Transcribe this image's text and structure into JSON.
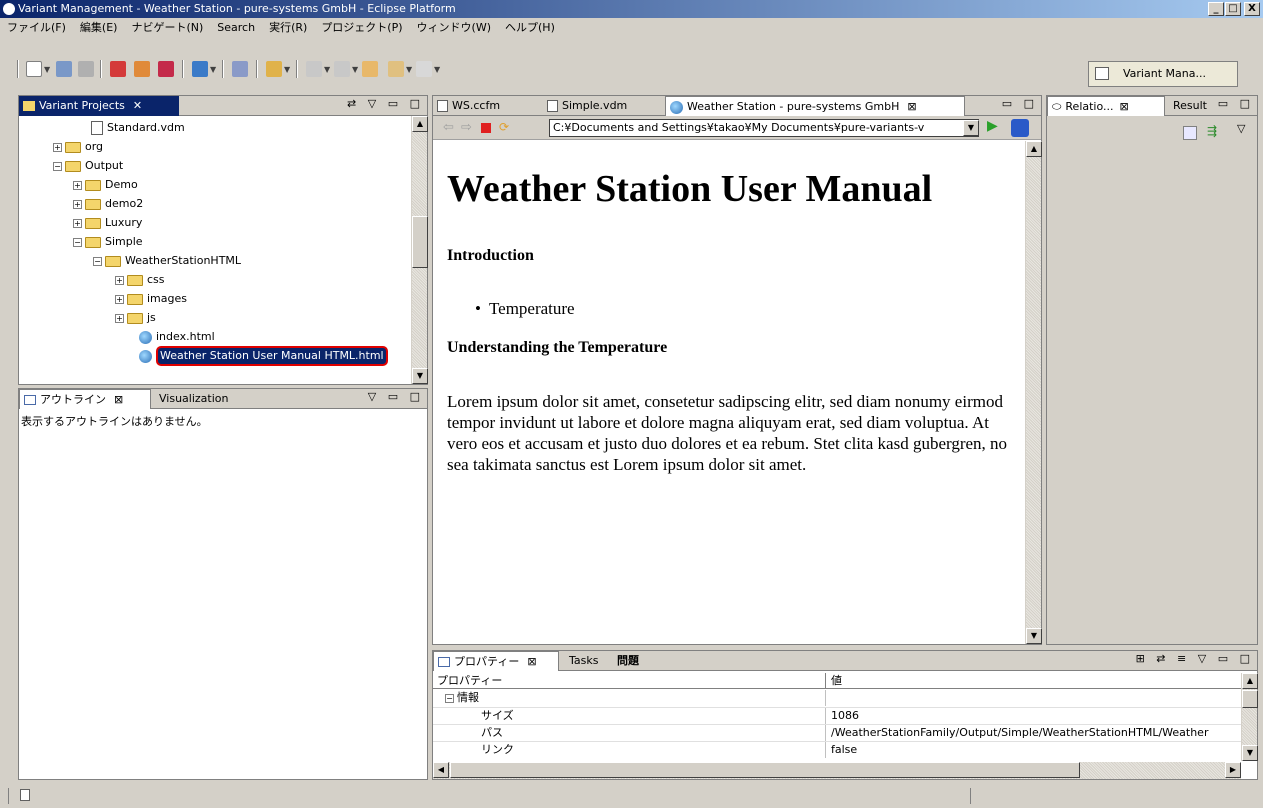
{
  "window": {
    "title": "Variant Management - Weather Station - pure-systems GmbH - Eclipse Platform",
    "controls": [
      "_",
      "□",
      "X"
    ]
  },
  "menu": [
    "ファイル(F)",
    "編集(E)",
    "ナビゲート(N)",
    "Search",
    "実行(R)",
    "プロジェクト(P)",
    "ウィンドウ(W)",
    "ヘルプ(H)"
  ],
  "perspective": {
    "label": "Variant Mana..."
  },
  "variant_projects": {
    "tab": "Variant Projects",
    "items": [
      {
        "label": "Standard.vdm",
        "icon": "document-icon",
        "expander": ""
      },
      {
        "label": "org",
        "icon": "folder-icon",
        "expander": "+"
      },
      {
        "label": "Output",
        "icon": "folder-icon",
        "expander": "−"
      },
      {
        "label": "Demo",
        "icon": "folder-icon",
        "expander": "+"
      },
      {
        "label": "demo2",
        "icon": "folder-icon",
        "expander": "+"
      },
      {
        "label": "Luxury",
        "icon": "folder-icon",
        "expander": "+"
      },
      {
        "label": "Simple",
        "icon": "folder-icon",
        "expander": "−"
      },
      {
        "label": "WeatherStationHTML",
        "icon": "folder-icon",
        "expander": "−"
      },
      {
        "label": "css",
        "icon": "folder-icon",
        "expander": "+"
      },
      {
        "label": "images",
        "icon": "folder-icon",
        "expander": "+"
      },
      {
        "label": "js",
        "icon": "folder-icon",
        "expander": "+"
      },
      {
        "label": "index.html",
        "icon": "web-page-icon",
        "expander": ""
      },
      {
        "label": "Weather Station User Manual HTML.html",
        "icon": "web-page-icon",
        "expander": "",
        "selected": true
      }
    ]
  },
  "outline": {
    "tabs": [
      "アウトライン",
      "Visualization"
    ],
    "empty_message": "表示するアウトラインはありません。"
  },
  "editor": {
    "tabs": [
      "WS.ccfm",
      "Simple.vdm",
      "Weather Station - pure-systems GmbH"
    ],
    "url": "C:¥Documents and Settings¥takao¥My Documents¥pure-variants-v",
    "document": {
      "title": "Weather Station User Manual",
      "h_intro": "Introduction",
      "bullet": "Temperature",
      "h_temp": "Understanding the Temperature",
      "paragraph": "Lorem ipsum dolor sit amet, consetetur sadipscing elitr, sed diam nonumy eirmod tempor invidunt ut labore et dolore magna aliquyam erat, sed diam voluptua. At vero eos et accusam et justo duo dolores et ea rebum. Stet clita kasd gubergren, no sea takimata sanctus est Lorem ipsum dolor sit amet."
    }
  },
  "right_panel": {
    "tabs": [
      "Relatio...",
      "Result"
    ]
  },
  "properties": {
    "tabs": [
      "プロパティー",
      "Tasks",
      "問題"
    ],
    "columns": [
      "プロパティー",
      "値"
    ],
    "group": "情報",
    "rows": [
      {
        "name": "サイズ",
        "value": "1086"
      },
      {
        "name": "パス",
        "value": "/WeatherStationFamily/Output/Simple/WeatherStationHTML/Weather"
      },
      {
        "name": "リンク",
        "value": "false"
      }
    ]
  },
  "colors": {
    "selection": "#0a246a",
    "highlight_ring": "#e00000",
    "title_gradient_start": "#0a246a",
    "title_gradient_end": "#a6caf0"
  }
}
